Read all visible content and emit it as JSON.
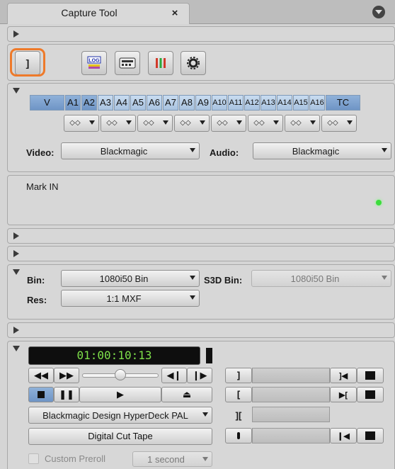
{
  "window": {
    "tab_title": "Capture Tool"
  },
  "toolbar": {
    "icons": [
      "mark-out-bracket-icon",
      "log-icon",
      "deck-icon",
      "audio-meter-icon",
      "gear-icon"
    ],
    "log_label": "LOG",
    "bracket_glyph": "]"
  },
  "tracks": {
    "labels": [
      "V",
      "A1",
      "A2",
      "A3",
      "A4",
      "A5",
      "A6",
      "A7",
      "A8",
      "A9",
      "A10",
      "A11",
      "A12",
      "A13",
      "A14",
      "A15",
      "A16",
      "TC"
    ],
    "pair_label": "◇◇"
  },
  "source": {
    "video_label": "Video:",
    "video_value": "Blackmagic",
    "audio_label": "Audio:",
    "audio_value": "Blackmagic"
  },
  "status": {
    "text": "Mark IN",
    "indicator_color": "#3cdc3c"
  },
  "bin": {
    "bin_label": "Bin:",
    "bin_value": "1080i50 Bin",
    "s3d_label": "S3D Bin:",
    "s3d_value": "1080i50 Bin",
    "res_label": "Res:",
    "res_value": "1:1  MXF"
  },
  "deck": {
    "timecode": "01:00:10:13",
    "deck_name": "Blackmagic Design HyperDeck PAL",
    "digital_cut": "Digital Cut Tape",
    "custom_preroll": "Custom Preroll",
    "preroll_value": "1 second"
  }
}
